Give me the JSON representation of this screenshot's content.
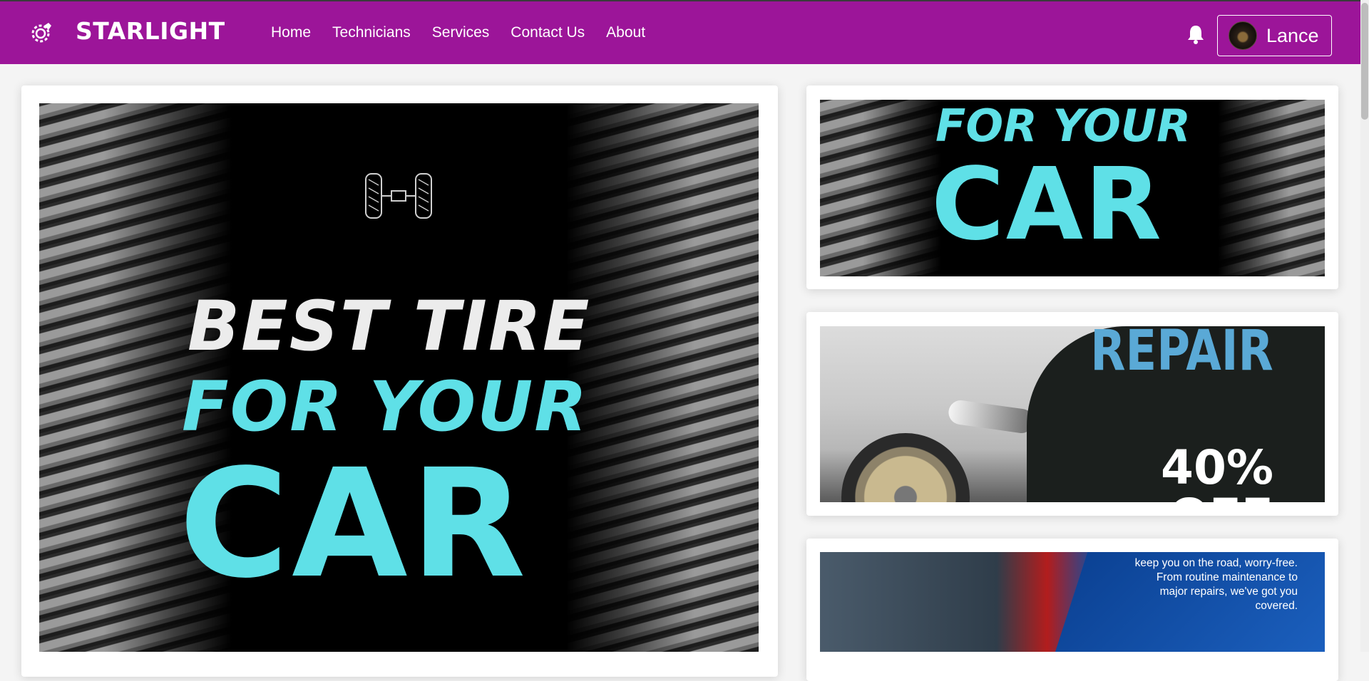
{
  "app": {
    "brand": "STARLIGHT"
  },
  "nav": {
    "items": [
      "Home",
      "Technicians",
      "Services",
      "Contact Us",
      "About"
    ]
  },
  "user": {
    "name": "Lance"
  },
  "main_poster": {
    "line1": "BEST TIRE",
    "line2": "FOR YOUR",
    "line3": "CAR"
  },
  "side_poster_1": {
    "line1": "FOR YOUR",
    "line2": "CAR"
  },
  "side_poster_2": {
    "headline": "REPAIR",
    "discount": "40%",
    "discount_cut": "OFF"
  },
  "side_poster_3": {
    "lines": [
      "keep you on the road, worry-free.",
      "From routine maintenance to",
      "major repairs, we've got you",
      "covered."
    ]
  },
  "colors": {
    "nav_bg": "#9c1599",
    "accent_cyan": "#5fe0e7",
    "repair_blue": "#5aa9d6"
  },
  "icons": {
    "logo": "gear-wrench-icon",
    "notifications": "bell-icon",
    "axle": "axle-icon"
  }
}
